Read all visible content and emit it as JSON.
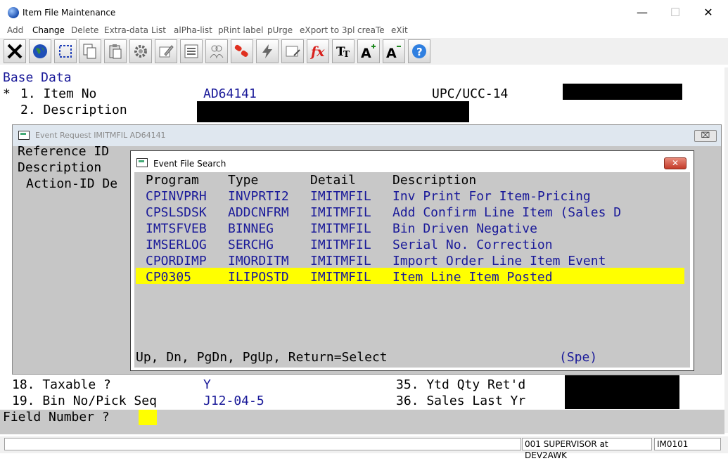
{
  "window": {
    "title": "Item File Maintenance",
    "min_glyph": "—",
    "max_glyph": "☐",
    "close_glyph": "✕"
  },
  "menu": [
    {
      "label": "Add"
    },
    {
      "label": "Change"
    },
    {
      "label": "Delete"
    },
    {
      "label": "Extra-data"
    },
    {
      "label": "List"
    },
    {
      "label": "alPha-list"
    },
    {
      "label": "pRint label"
    },
    {
      "label": "pUrge"
    },
    {
      "label": "eXport to 3pl"
    },
    {
      "label": "creaTe"
    },
    {
      "label": "eXit"
    }
  ],
  "toolbar": {
    "icons": [
      "exit-icon",
      "globe-icon",
      "select-icon",
      "copy-icon",
      "paste-icon",
      "settings-icon",
      "edit-icon",
      "list-icon",
      "users-icon",
      "link-icon",
      "lightning-icon",
      "window-edit-icon",
      "function-icon",
      "font-size-icon",
      "font-increase-icon",
      "font-decrease-icon",
      "help-icon"
    ]
  },
  "base": {
    "header": "Base Data",
    "star": "*",
    "f1_label": "1. Item No",
    "f1_value": "AD64141",
    "upc_label": "UPC/UCC-14",
    "f2_label": "2. Description",
    "f18_label": "18. Taxable ?",
    "f18_value": "Y",
    "f19_label": "19. Bin No/Pick Seq",
    "f19_value": "J12-04-5",
    "f35_label": "35. Ytd Qty Ret'd",
    "f36_label": "36. Sales Last Yr",
    "prompt": "Field Number ?"
  },
  "event_request": {
    "title": "Event Request IMITMFIL AD64141",
    "close_glyph": "⌧",
    "ref_label": "Reference ID",
    "desc_label": "Description",
    "action_label": "Action-ID De"
  },
  "file_search": {
    "title": "Event File Search",
    "close_glyph": "✕",
    "headers": {
      "program": "Program",
      "type": "Type",
      "detail": "Detail",
      "description": "Description"
    },
    "rows": [
      {
        "program": "CPINVPRH",
        "type": "INVPRTI2",
        "detail": "IMITMFIL",
        "description": "Inv Print For Item-Pricing"
      },
      {
        "program": "CPSLSDSK",
        "type": "ADDCNFRM",
        "detail": "IMITMFIL",
        "description": "Add Confirm Line Item (Sales D"
      },
      {
        "program": "IMTSFVEB",
        "type": "BINNEG",
        "detail": "IMITMFIL",
        "description": "Bin Driven Negative"
      },
      {
        "program": "IMSERLOG",
        "type": "SERCHG",
        "detail": "IMITMFIL",
        "description": "Serial No. Correction"
      },
      {
        "program": "CPORDIMP",
        "type": "IMORDITM",
        "detail": "IMITMFIL",
        "description": "Import Order Line Item Event"
      },
      {
        "program": "CP0305",
        "type": "ILIPOSTD",
        "detail": "IMITMFIL",
        "description": "Item Line Item Posted"
      }
    ],
    "footer": "Up, Dn, PgDn, PgUp, Return=Select",
    "footer_right": "(Spe)"
  },
  "status": {
    "user": "001 SUPERVISOR at DEV2AWK",
    "program": "IM0101"
  },
  "colors": {
    "highlight": "#ffff00",
    "value_text": "#1a1a99"
  }
}
